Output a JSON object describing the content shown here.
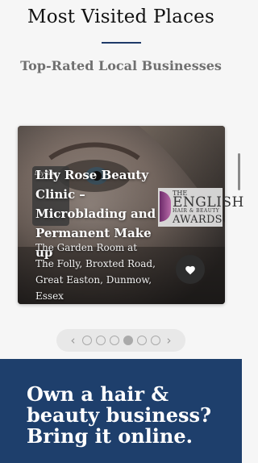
{
  "header": {
    "title": "Most Visited Places",
    "subtitle": "Top-Rated Local Businesses"
  },
  "card": {
    "title": "Lily Rose Beauty Clinic – Microblading and Permanent Make up",
    "address": "The Garden Room at The Folly, Broxted Road, Great Easton, Dunmow, Essex",
    "logo_text": "Lily Rose",
    "award": {
      "line1": "THE",
      "line2": "ENGLISH",
      "line3": "HAIR & BEAUTY",
      "line4": "AWARDS"
    },
    "favorite_icon": "heart-icon"
  },
  "pager": {
    "prev_icon": "‹",
    "next_icon": "›",
    "dot_count": 6,
    "active_index": 3
  },
  "promo": {
    "text": "Own a hair & beauty business? Bring it online."
  },
  "colors": {
    "accent": "#1f3a68",
    "promo_bg": "#1e3f6c",
    "subtitle": "#707070"
  }
}
